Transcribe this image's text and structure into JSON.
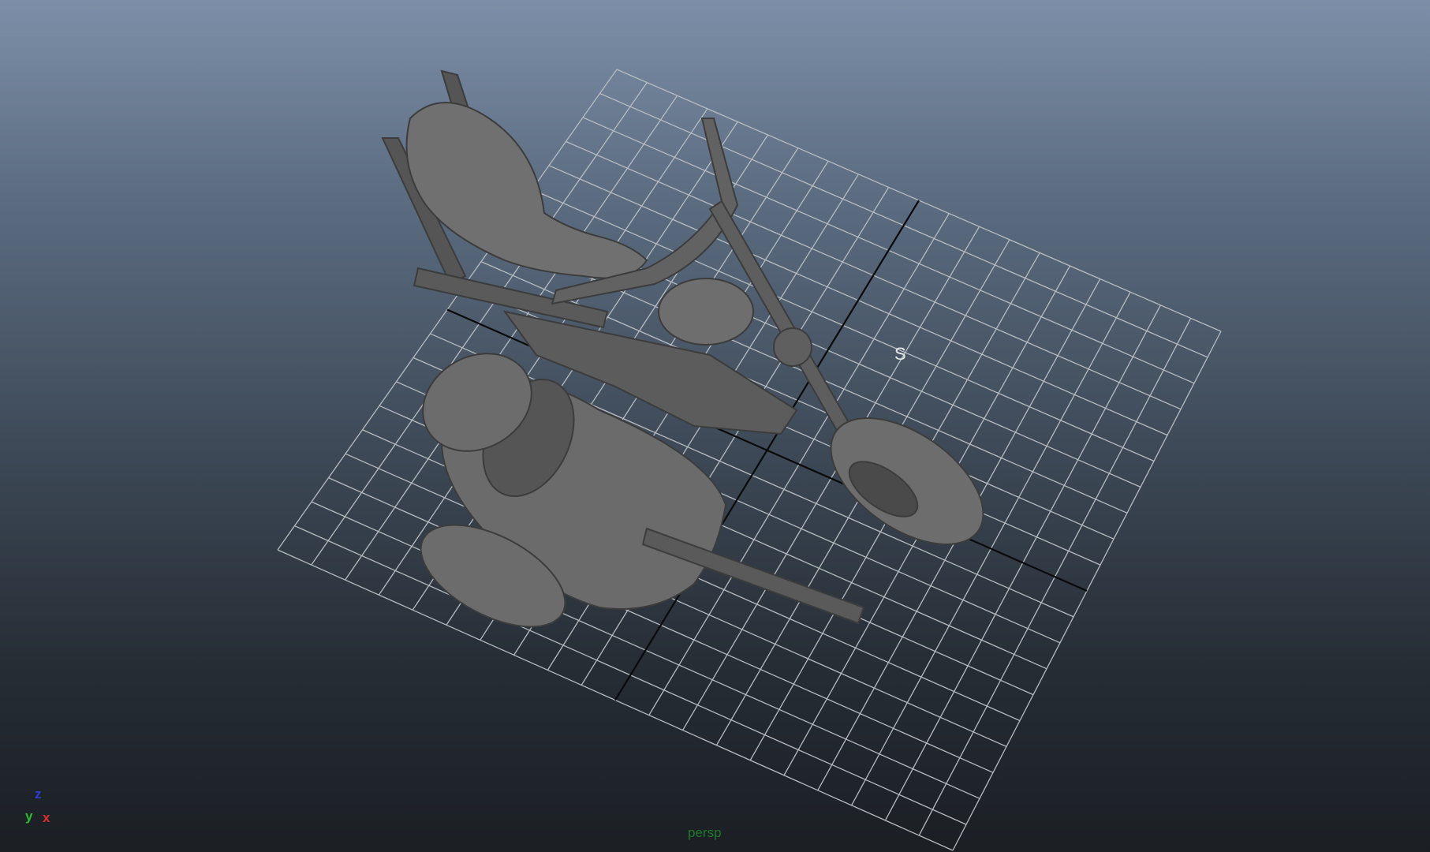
{
  "viewport": {
    "camera_name": "persp",
    "object_label": "S",
    "colors": {
      "bg_top": "#7d8fa8",
      "bg_bottom": "#1b1f24",
      "grid": "#b8bcc0",
      "grid_axis": "#0a0a0a",
      "model": "#6b6b6b"
    }
  },
  "axis_gizmo": {
    "z_label": "z",
    "y_label": "y",
    "x_label": "x",
    "colors": {
      "x": "#e0302a",
      "y": "#2ebd2e",
      "z": "#2b3fd8"
    }
  },
  "scene": {
    "object": "motorcycle-with-sidecar",
    "grid_divisions": 20
  }
}
